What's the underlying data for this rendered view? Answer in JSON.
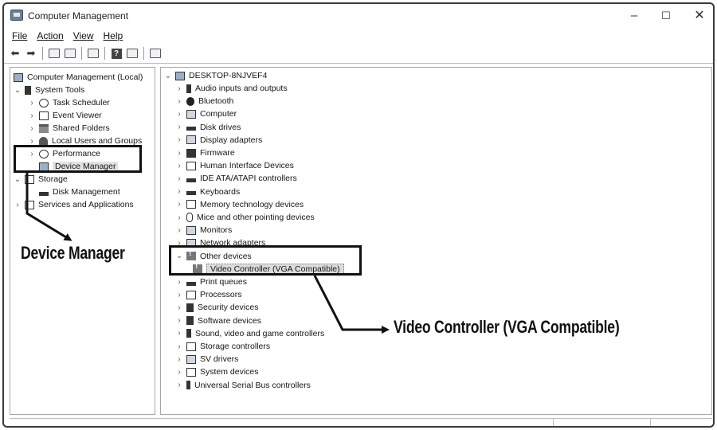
{
  "window": {
    "title": "Computer Management",
    "minimize": "–",
    "maximize": "☐",
    "close": "✕"
  },
  "menu": [
    "File",
    "Action",
    "View",
    "Help"
  ],
  "left_tree": {
    "root": "Computer Management (Local)",
    "system_tools": "System Tools",
    "task_scheduler": "Task Scheduler",
    "event_viewer": "Event Viewer",
    "shared_folders": "Shared Folders",
    "local_users": "Local Users and Groups",
    "performance": "Performance",
    "device_manager": "Device Manager",
    "storage": "Storage",
    "disk_management": "Disk Management",
    "services": "Services and Applications"
  },
  "right_tree": {
    "computer": "DESKTOP-8NJVEF4",
    "categories": [
      "Audio inputs and outputs",
      "Bluetooth",
      "Computer",
      "Disk drives",
      "Display adapters",
      "Firmware",
      "Human Interface Devices",
      "IDE ATA/ATAPI controllers",
      "Keyboards",
      "Memory technology devices",
      "Mice and other pointing devices",
      "Monitors",
      "Network adapters",
      "Other devices",
      "Video Controller (VGA Compatible)",
      "Print queues",
      "Processors",
      "Security devices",
      "Software devices",
      "Sound, video and game controllers",
      "Storage controllers",
      "SV drivers",
      "System devices",
      "Universal Serial Bus controllers"
    ]
  },
  "annotations": {
    "device_manager_label": "Device Manager",
    "video_controller_label": "Video Controller (VGA Compatible)"
  },
  "icons": [
    "app-icon",
    "back-arrow-icon",
    "forward-arrow-icon",
    "up-folder-icon",
    "properties-icon",
    "help-icon",
    "console-icon"
  ]
}
